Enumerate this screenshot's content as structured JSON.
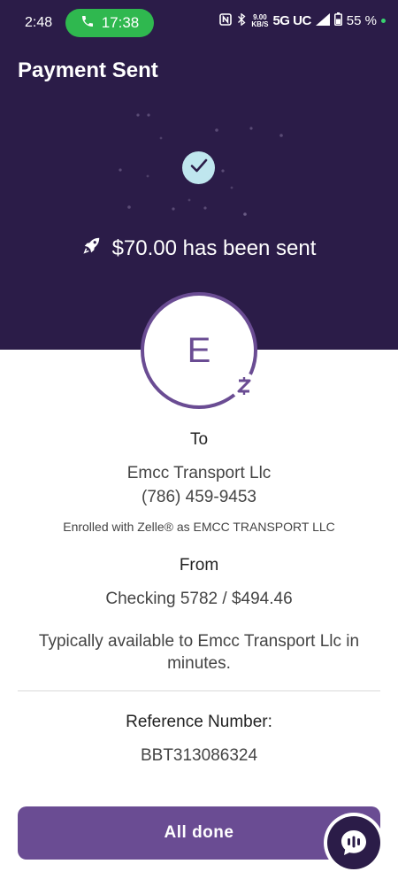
{
  "status_bar": {
    "time": "2:48",
    "call_time": "17:38",
    "data_speed_top": "9.00",
    "data_speed_bottom": "KB/S",
    "network": "5G UC",
    "battery": "55 %"
  },
  "header": {
    "title": "Payment Sent"
  },
  "confirmation": {
    "amount_message": "$70.00 has been sent"
  },
  "recipient": {
    "initial": "E",
    "to_label": "To",
    "name": "Emcc Transport Llc",
    "phone": "(786) 459-9453",
    "enrolled_note": "Enrolled with Zelle® as EMCC TRANSPORT LLC"
  },
  "source": {
    "from_label": "From",
    "account": "Checking 5782 / $494.46"
  },
  "availability_note": "Typically available to Emcc Transport Llc in minutes.",
  "reference": {
    "label": "Reference Number:",
    "number": "BBT313086324"
  },
  "actions": {
    "done_label": "All done"
  },
  "colors": {
    "header_bg": "#2b1c48",
    "accent": "#6a4c93",
    "check_bg": "#bfe6ee",
    "call_green": "#2fb84f"
  },
  "icons": {
    "phone": "phone-icon",
    "check": "checkmark-icon",
    "send": "rocket-send-icon",
    "zelle": "zelle-z-icon",
    "chat": "chat-assistant-icon"
  }
}
